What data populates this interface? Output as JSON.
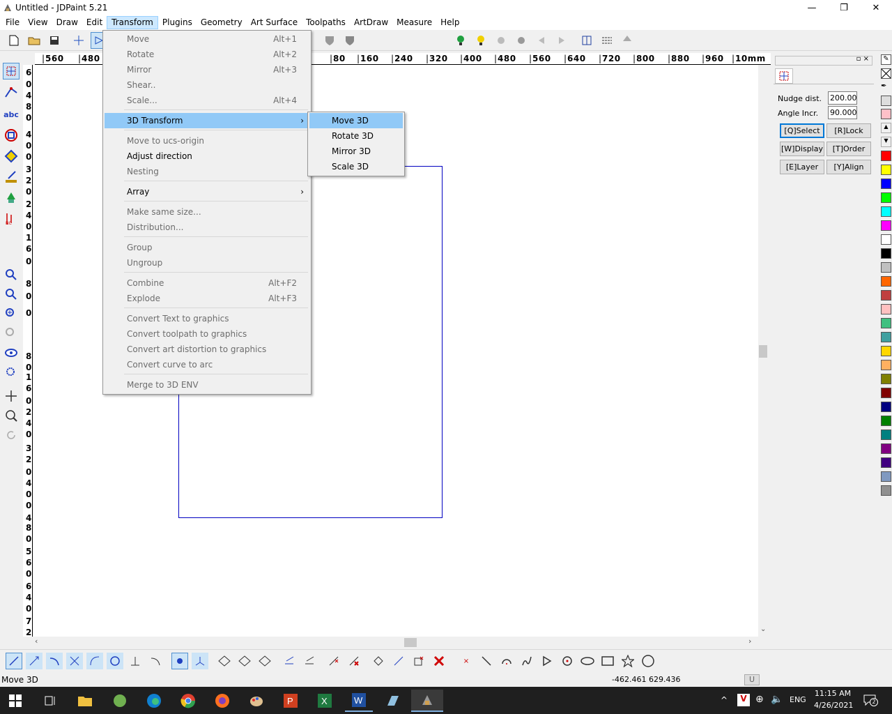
{
  "window": {
    "title": "Untitled - JDPaint 5.21",
    "minimize": "—",
    "maximize": "❐",
    "close": "✕"
  },
  "menubar": [
    "File",
    "View",
    "Draw",
    "Edit",
    "Transform",
    "Plugins",
    "Geometry",
    "Art Surface",
    "Toolpaths",
    "ArtDraw",
    "Measure",
    "Help"
  ],
  "ruler_top": [
    "560",
    "480",
    "80",
    "160",
    "240",
    "320",
    "400",
    "480",
    "560",
    "640",
    "720",
    "800",
    "880",
    "960",
    "10mm"
  ],
  "ruler_left": [
    "6",
    "0",
    "4",
    "8",
    "0",
    "4",
    "0",
    "0",
    "3",
    "2",
    "0",
    "2",
    "4",
    "0",
    "1",
    "6",
    "0",
    "8",
    "0",
    "0",
    "8",
    "0",
    "1",
    "6",
    "0",
    "2",
    "4",
    "0",
    "3",
    "2",
    "0",
    "4",
    "0",
    "0",
    "4",
    "8",
    "0",
    "5",
    "6",
    "0",
    "6",
    "4",
    "0",
    "7",
    "2"
  ],
  "transform_menu": {
    "items": [
      {
        "label": "Move",
        "accel": "Alt+1",
        "enabled": false
      },
      {
        "label": "Rotate",
        "accel": "Alt+2",
        "enabled": false
      },
      {
        "label": "Mirror",
        "accel": "Alt+3",
        "enabled": false
      },
      {
        "label": "Shear..",
        "accel": "",
        "enabled": false
      },
      {
        "label": "Scale...",
        "accel": "Alt+4",
        "enabled": false
      },
      {
        "label": "3D Transform",
        "accel": "",
        "enabled": true,
        "submenu": true,
        "highlighted": true
      },
      {
        "label": "Move to ucs-origin",
        "accel": "",
        "enabled": false
      },
      {
        "label": "Adjust direction",
        "accel": "",
        "enabled": true
      },
      {
        "label": "Nesting",
        "accel": "",
        "enabled": false
      },
      {
        "label": "Array",
        "accel": "",
        "enabled": true,
        "submenu": true
      },
      {
        "label": "Make same size...",
        "accel": "",
        "enabled": false
      },
      {
        "label": "Distribution...",
        "accel": "",
        "enabled": false
      },
      {
        "label": "Group",
        "accel": "",
        "enabled": false
      },
      {
        "label": "Ungroup",
        "accel": "",
        "enabled": false
      },
      {
        "label": "Combine",
        "accel": "Alt+F2",
        "enabled": false
      },
      {
        "label": "Explode",
        "accel": "Alt+F3",
        "enabled": false
      },
      {
        "label": "Convert Text to graphics",
        "accel": "",
        "enabled": false
      },
      {
        "label": "Convert toolpath to graphics",
        "accel": "",
        "enabled": false
      },
      {
        "label": "Convert art distortion to graphics",
        "accel": "",
        "enabled": false
      },
      {
        "label": "Convert curve to arc",
        "accel": "",
        "enabled": false
      },
      {
        "label": "Merge to 3D ENV",
        "accel": "",
        "enabled": false
      }
    ]
  },
  "submenu_3d": [
    "Move 3D",
    "Rotate 3D",
    "Mirror 3D",
    "Scale 3D"
  ],
  "right_panel": {
    "nudge_label": "Nudge dist.",
    "nudge_value": "200.000",
    "angle_label": "Angle Incr.",
    "angle_value": "90.000",
    "buttons": [
      "[Q]Select",
      "[R]Lock",
      "[W]Display",
      "[T]Order",
      "[E]Layer",
      "[Y]Align"
    ]
  },
  "palette": [
    "#ff0000",
    "#ffff00",
    "#0000ff",
    "#00ff00",
    "#00ffff",
    "#ff00ff",
    "#ffffff",
    "#000000",
    "#c0c0c0",
    "#ff6600",
    "#c04040",
    "#ffc0c0",
    "#40c080",
    "#40a0a0",
    "#ffd700",
    "#ffb060",
    "#808000",
    "#800000",
    "#000080",
    "#008000",
    "#008080",
    "#800080",
    "#400080",
    "#8099c0",
    "#909090"
  ],
  "status": {
    "left": "Move 3D",
    "coords": "-462.461 629.436",
    "mode": "U"
  },
  "taskbar": {
    "time": "11:15 AM",
    "date": "4/26/2021",
    "lang": "ENG",
    "notif": "2"
  }
}
